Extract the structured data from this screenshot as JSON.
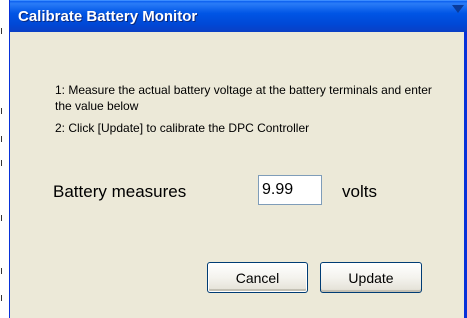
{
  "window": {
    "title": "Calibrate Battery Monitor"
  },
  "instructions": [
    "1: Measure the actual battery voltage at the battery terminals and enter the value below",
    "2: Click [Update] to calibrate the DPC Controller"
  ],
  "form": {
    "label": "Battery measures",
    "voltage_value": "9.99",
    "unit": "volts"
  },
  "buttons": {
    "cancel_label": "Cancel",
    "update_label": "Update"
  },
  "colors": {
    "titlebar": "#0055e5",
    "dialog_bg": "#ece9d8",
    "button_border": "#003c74"
  }
}
